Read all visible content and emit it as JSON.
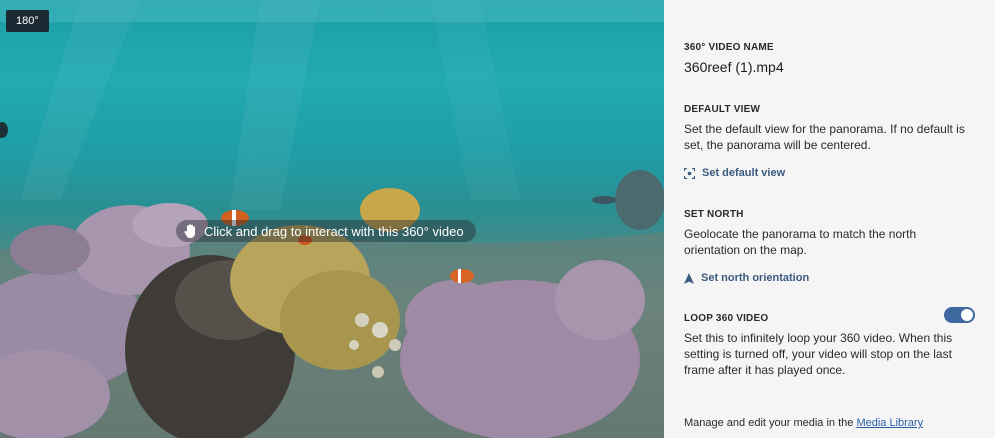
{
  "viewer": {
    "badge": "180°",
    "hint": "Click and drag to interact with this 360° video"
  },
  "panel": {
    "video_name": {
      "label": "360° VIDEO NAME",
      "value": "360reef (1).mp4"
    },
    "default_view": {
      "label": "DEFAULT VIEW",
      "description": "Set the default view for the panorama. If no default is set, the panorama will be centered.",
      "action": "Set default view"
    },
    "set_north": {
      "label": "SET NORTH",
      "description": "Geolocate the panorama to match the north orientation on the map.",
      "action": "Set north orientation"
    },
    "loop": {
      "label": "LOOP 360 VIDEO",
      "description": "Set this to infinitely loop your 360 video. When this setting is turned off, your video will stop on the last frame after it has played once.",
      "enabled": true
    },
    "footer": {
      "text": "Manage and edit your media in the ",
      "link": "Media Library"
    }
  },
  "colors": {
    "accent": "#3f68a0",
    "link": "#2b5fa8",
    "panel_bg": "#f5f5f6"
  }
}
